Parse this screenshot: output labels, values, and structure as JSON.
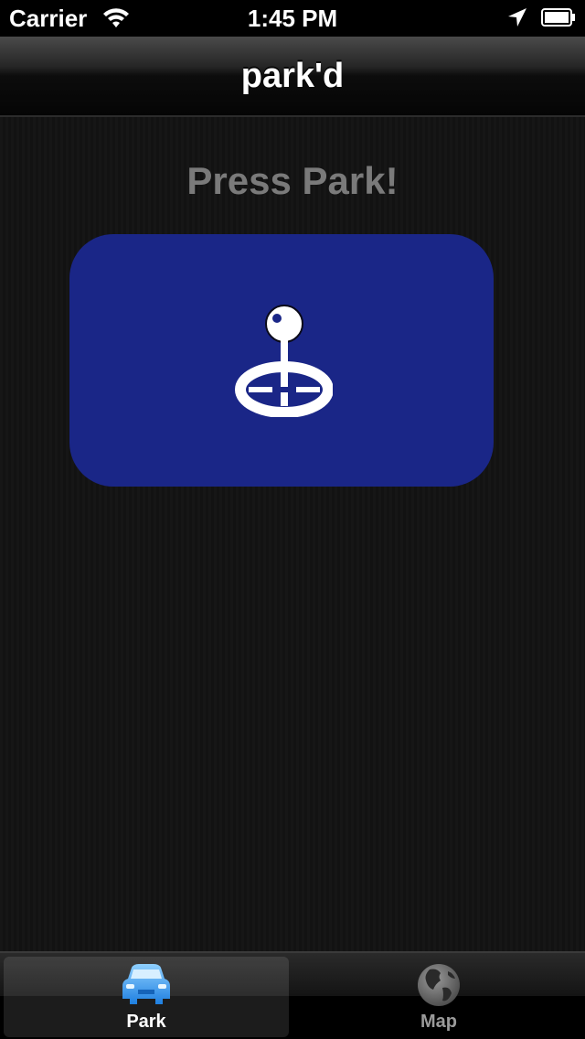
{
  "status_bar": {
    "carrier": "Carrier",
    "time": "1:45 PM",
    "icons": [
      "wifi-icon",
      "location-arrow-icon",
      "battery-icon"
    ]
  },
  "nav_bar": {
    "title": "park'd"
  },
  "main": {
    "prompt": "Press Park!",
    "park_button": {
      "icon": "map-pin-crosshair-icon",
      "color": "#1a2687"
    }
  },
  "tab_bar": {
    "tabs": [
      {
        "label": "Park",
        "icon": "car-icon",
        "selected": true
      },
      {
        "label": "Map",
        "icon": "globe-icon",
        "selected": false
      }
    ]
  }
}
